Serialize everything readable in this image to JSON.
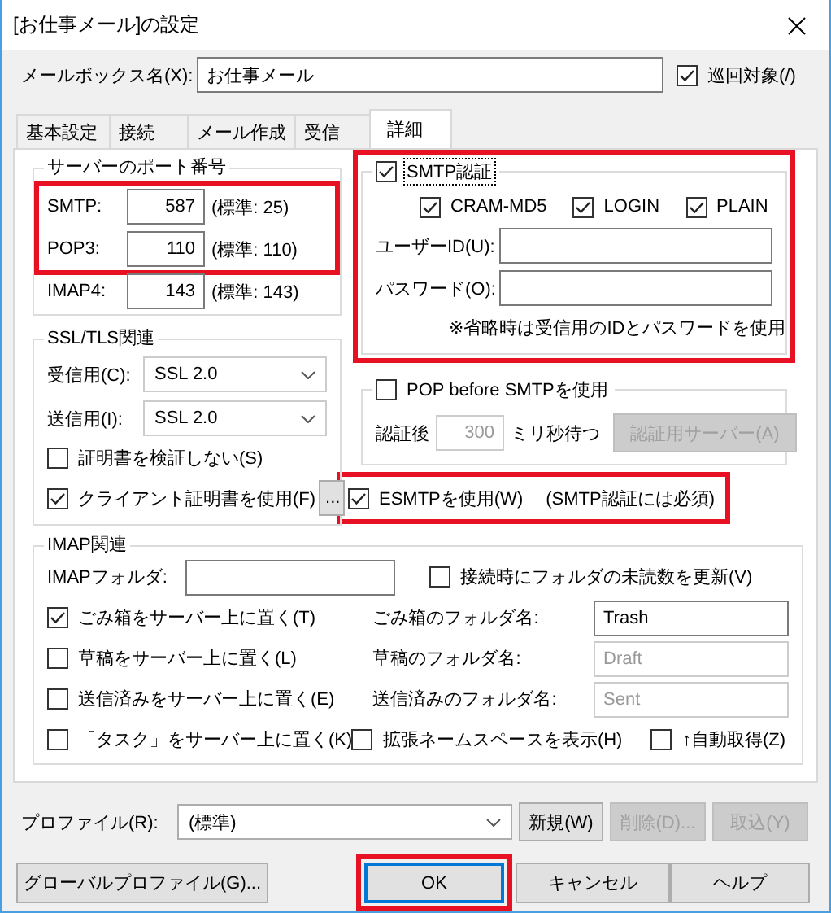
{
  "window": {
    "title": "[お仕事メール]の設定"
  },
  "mailbox": {
    "label": "メールボックス名(X):",
    "value": "お仕事メール",
    "patrol": {
      "label": "巡回対象(/)",
      "checked": true
    }
  },
  "tabs": [
    {
      "label": "基本設定",
      "selected": false
    },
    {
      "label": "接続",
      "selected": false
    },
    {
      "label": "メール作成",
      "selected": false
    },
    {
      "label": "受信",
      "selected": false
    },
    {
      "label": "詳細",
      "selected": true
    }
  ],
  "ports": {
    "title": "サーバーのポート番号",
    "rows": [
      {
        "label": "SMTP:",
        "value": "587",
        "default": "(標準: 25)",
        "highlighted": true
      },
      {
        "label": "POP3:",
        "value": "110",
        "default": "(標準: 110)",
        "highlighted": true
      },
      {
        "label": "IMAP4:",
        "value": "143",
        "default": "(標準: 143)",
        "highlighted": false
      }
    ]
  },
  "ssl": {
    "title": "SSL/TLS関連",
    "combos": [
      {
        "label": "受信用(C):",
        "value": "SSL 2.0"
      },
      {
        "label": "送信用(I):",
        "value": "SSL 2.0"
      }
    ],
    "checks": [
      {
        "label": "証明書を検証しない(S)",
        "checked": false
      },
      {
        "label": "クライアント証明書を使用(F)",
        "checked": true
      }
    ],
    "browse_button": "..."
  },
  "smtp_auth": {
    "label": "SMTP認証",
    "checked": true,
    "focused": true,
    "highlighted": true,
    "methods": [
      {
        "label": "CRAM-MD5",
        "checked": true
      },
      {
        "label": "LOGIN",
        "checked": true
      },
      {
        "label": "PLAIN",
        "checked": true
      }
    ],
    "fields": [
      {
        "label": "ユーザーID(U):"
      },
      {
        "label": "パスワード(O):"
      }
    ],
    "note": "※省略時は受信用のIDとパスワードを使用"
  },
  "pop_before_smtp": {
    "label": "POP before SMTPを使用",
    "checked": false,
    "wait_label": "認証後",
    "wait_value": "300",
    "wait_unit": "ミリ秒待つ",
    "server_button": "認証用サーバー(A)"
  },
  "esmtp": {
    "label": "ESMTPを使用(W)",
    "checked": true,
    "note": "(SMTP認証には必須)",
    "highlighted": true
  },
  "imap": {
    "title": "IMAP関連",
    "folder_label": "IMAPフォルダ:",
    "update_check": {
      "label": "接続時にフォルダの未読数を更新(V)",
      "checked": false
    },
    "server_folders": [
      {
        "label": "ごみ箱をサーバー上に置く(T)",
        "checked": true,
        "name_label": "ごみ箱のフォルダ名:",
        "name_value": "Trash"
      },
      {
        "label": "草稿をサーバー上に置く(L)",
        "checked": false,
        "name_label": "草稿のフォルダ名:",
        "name_value": "Draft"
      },
      {
        "label": "送信済みをサーバー上に置く(E)",
        "checked": false,
        "name_label": "送信済みのフォルダ名:",
        "name_value": "Sent"
      }
    ],
    "bottom_checks": [
      {
        "label": "「タスク」をサーバー上に置く(K)",
        "checked": false
      },
      {
        "label": "拡張ネームスペースを表示(H)",
        "checked": false
      },
      {
        "label": "↑自動取得(Z)",
        "checked": false
      }
    ]
  },
  "profile": {
    "label": "プロファイル(R):",
    "value": "(標準)",
    "buttons": [
      {
        "label": "新規(W)",
        "disabled": false
      },
      {
        "label": "削除(D)...",
        "disabled": true
      },
      {
        "label": "取込(Y)",
        "disabled": true
      }
    ]
  },
  "buttons": [
    {
      "label": "グローバルプロファイル(G)...",
      "default": false,
      "highlighted": false
    },
    {
      "label": "OK",
      "default": true,
      "highlighted": true
    },
    {
      "label": "キャンセル",
      "default": false,
      "highlighted": false
    },
    {
      "label": "ヘルプ",
      "default": false,
      "highlighted": false
    }
  ]
}
